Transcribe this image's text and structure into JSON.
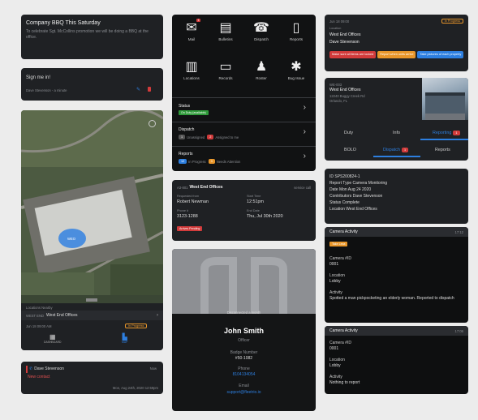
{
  "announcement": {
    "title": "Company BBQ This Saturday",
    "body": "To celebrate Sgt. McCollins promotion we will be doing a BBQ at the office."
  },
  "signin": {
    "title": "Sign me in!",
    "user": "Dave Stevenson - a minute"
  },
  "map": {
    "label": "WEO",
    "location_label": "Locations Nearby",
    "location": "WEST END",
    "location_name": "West End Offices",
    "shift_time": "Jun 18 09:00 AM",
    "shift_status": "In Progress",
    "nav_dashboard": "DASHBOARD",
    "nav_map": "MAP"
  },
  "message": {
    "sender": "Dave Stevenson",
    "time": "Now",
    "body": "New contact",
    "date": "Mon, Aug 24th, 2020 12:59pm"
  },
  "menu": {
    "items": [
      {
        "label": "Mail",
        "icon": "mail-icon",
        "badge": "1"
      },
      {
        "label": "Bulletins",
        "icon": "bulletin-icon"
      },
      {
        "label": "Dispatch",
        "icon": "dispatch-icon"
      },
      {
        "label": "Reports",
        "icon": "reports-icon"
      },
      {
        "label": "Locations",
        "icon": "building-icon"
      },
      {
        "label": "Records",
        "icon": "records-icon"
      },
      {
        "label": "Roster",
        "icon": "roster-icon"
      },
      {
        "label": "Bug Issue",
        "icon": "bug-icon"
      }
    ],
    "status": {
      "title": "Status",
      "badge": "On Duty (available)"
    },
    "dispatch": {
      "title": "Dispatch",
      "badge1": "1",
      "text1": "Unassigned",
      "badge2": "2",
      "text2": "Assigned to me"
    },
    "reports": {
      "title": "Reports",
      "badge1": "12",
      "text1": "In Progress",
      "badge2": "3",
      "text2": "Needs Attention"
    }
  },
  "visit": {
    "code": "A3-801",
    "location": "West End Offices",
    "service_call": "service call",
    "requested_by_label": "Requested from",
    "requested_by": "Robert Newman",
    "start_time_label": "Start Time",
    "start_time": "12:51pm",
    "phone_label": "Phone #",
    "phone": "3123-1288",
    "date_label": "End Date",
    "date": "Thu, Jul 30th 2020",
    "status": "Arrives Pending"
  },
  "profile": {
    "banner": "Disconnected a month",
    "name": "John Smith",
    "role": "Officer",
    "badge_label": "Badge Number",
    "badge": "#50-1082",
    "phone_label": "Phone",
    "phone": "8104134054",
    "email_label": "Email",
    "email": "support@fleetrio.io"
  },
  "shift": {
    "time": "Jun 18 09:00",
    "status": "In Progress",
    "location_label": "Location",
    "location": "West End Offices",
    "officer": "Dave Stevenson",
    "tags": [
      "Make sure all items are locked",
      "Report when units arrive",
      "Take pictures of each property"
    ]
  },
  "site": {
    "id": "WE-003",
    "name": "West End Offices",
    "address": "12240 Buggy Creek Rd",
    "city": "Orlando, FL"
  },
  "tabs": {
    "row1": [
      "Duty",
      "Info",
      "Reporting"
    ],
    "reporting_badge": "1",
    "row2": [
      "BOLO",
      "Dispatch",
      "Reports"
    ],
    "dispatch_badge": "1"
  },
  "report": {
    "id": "ID SPS200824-1",
    "type": "Report Type Camera Monitoring",
    "date": "Date Mon Aug 24 2020",
    "contributor": "Contributors Dave Stevenson",
    "status": "Status Complete",
    "location": "Location West End Offices"
  },
  "activities": [
    {
      "title": "Camera Activity",
      "time": "17:12",
      "tag": "Take Lexa",
      "camera_label": "Camera #ID",
      "camera": "0001",
      "location_label": "Location",
      "location": "Lobby",
      "activity_label": "Activity",
      "activity": "Spotted a man pickpocketing an elderly woman. Reported to dispatch"
    },
    {
      "title": "Camera Activity",
      "time": "17:06",
      "camera_label": "Camera #ID",
      "camera": "0001",
      "location_label": "Location",
      "location": "Lobby",
      "activity_label": "Activity",
      "activity": "Nothing to report"
    }
  ],
  "colors": {
    "accent": "#2d7fe0",
    "green": "#2f9a3a",
    "orange": "#e8962a",
    "red": "#d23b3b"
  }
}
